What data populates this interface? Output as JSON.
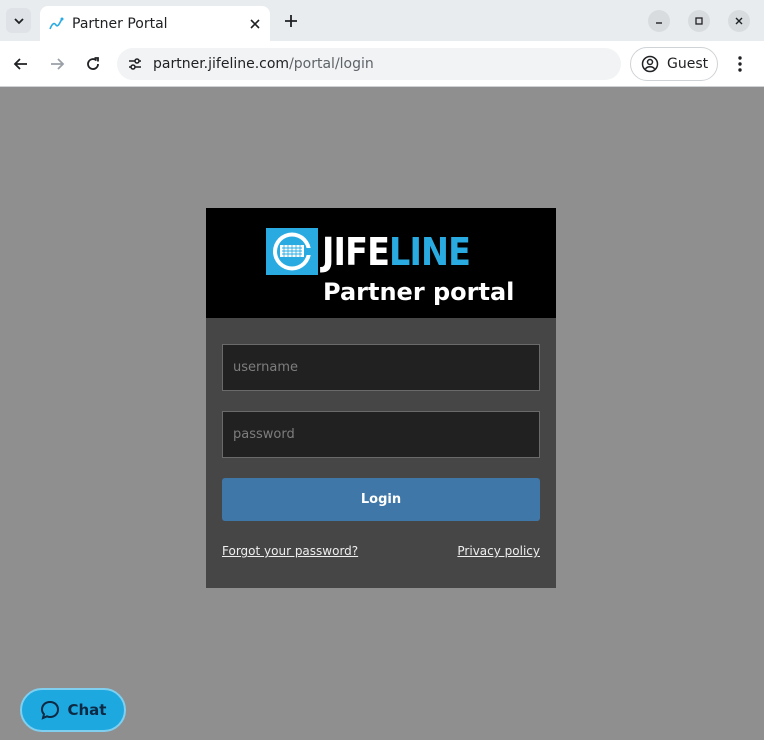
{
  "browser": {
    "tab_title": "Partner Portal",
    "url_host": "partner.jifeline.com",
    "url_path": "/portal/login",
    "profile_label": "Guest"
  },
  "brand": {
    "logo_white": "JIFE",
    "logo_blue": "LINE",
    "subtitle": "Partner portal",
    "accent_color": "#29abe2"
  },
  "login": {
    "username_placeholder": "username",
    "password_placeholder": "password",
    "login_label": "Login",
    "forgot_label": "Forgot your password?",
    "privacy_label": "Privacy policy"
  },
  "chat": {
    "label": "Chat"
  }
}
